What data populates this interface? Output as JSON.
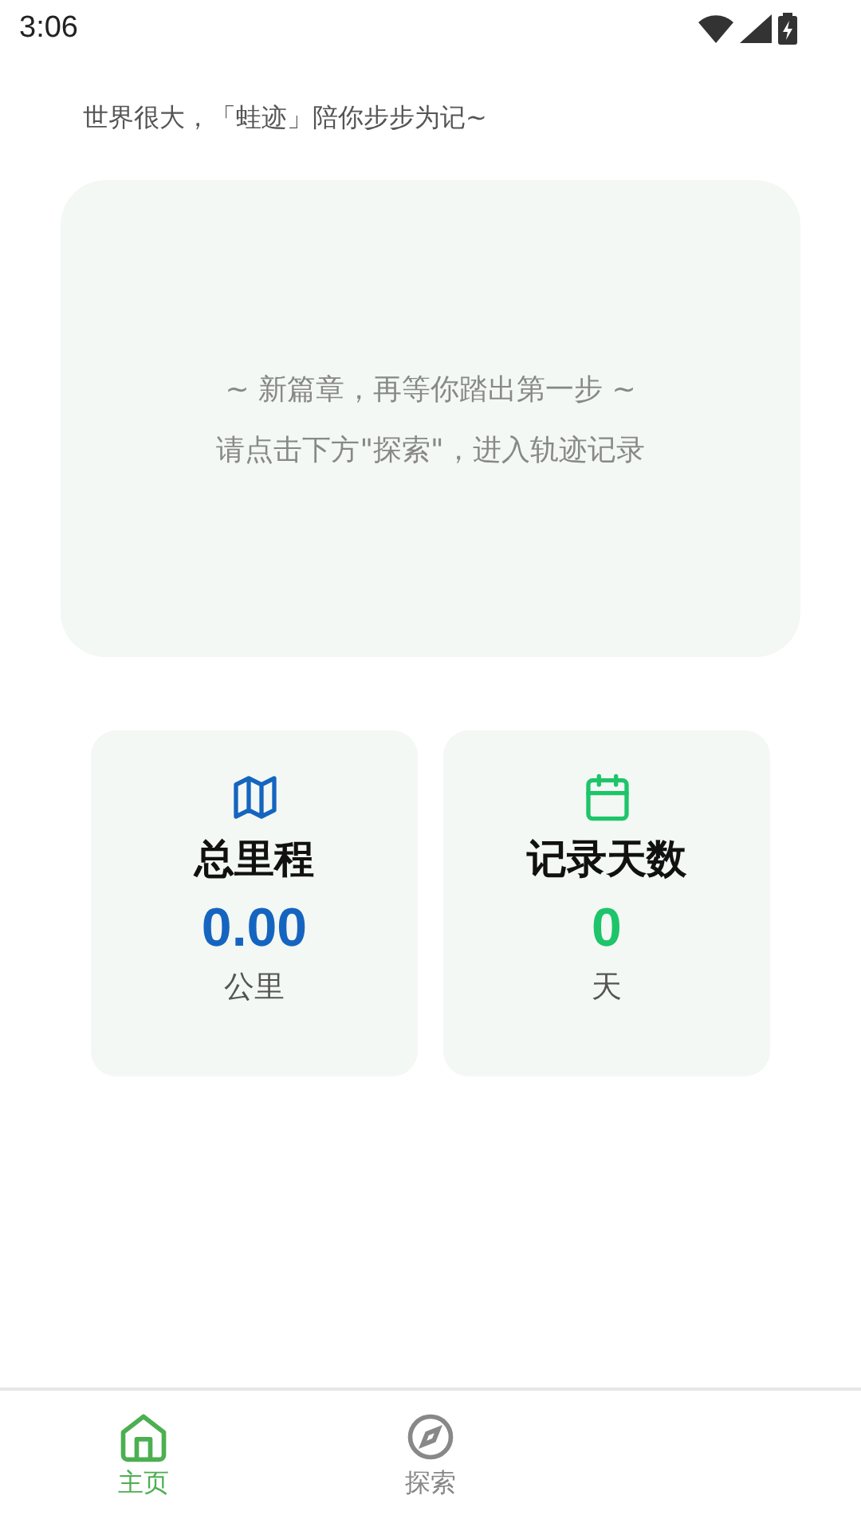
{
  "status_bar": {
    "time": "3:06"
  },
  "slogan": "世界很大，「蛙迹」陪你步步为记~",
  "empty_card": {
    "lines": [
      "~ 新篇章，再等你踏出第一步 ~",
      "请点击下方\"探索\"，进入轨迹记录"
    ]
  },
  "stats": [
    {
      "kind": "map",
      "title": "总里程",
      "value": "0.00",
      "unit": "公里",
      "color": "#1565c0"
    },
    {
      "kind": "calendar",
      "title": "记录天数",
      "value": "0",
      "unit": "天",
      "color": "#1ec46a"
    }
  ],
  "tabs": [
    {
      "kind": "home",
      "label": "主页",
      "selected": true
    },
    {
      "kind": "explore",
      "label": "探索",
      "selected": false
    }
  ]
}
